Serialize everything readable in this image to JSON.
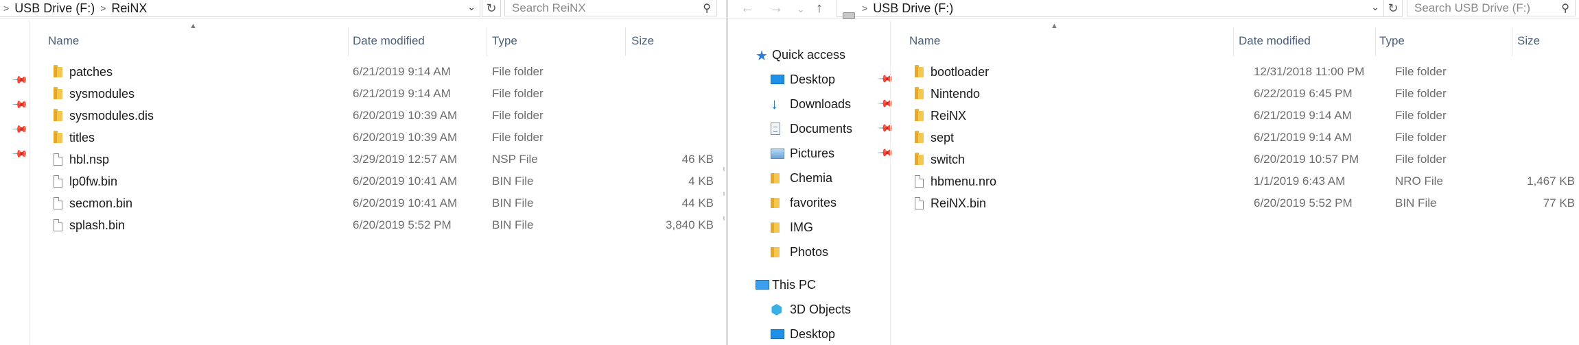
{
  "left": {
    "breadcrumb": [
      "USB Drive (F:)",
      "ReiNX"
    ],
    "search_placeholder": "Search ReiNX",
    "columns": {
      "name": "Name",
      "date": "Date modified",
      "type": "Type",
      "size": "Size"
    },
    "files": [
      {
        "name": "patches",
        "date": "6/21/2019 9:14 AM",
        "type": "File folder",
        "size": "",
        "icon": "folder-icon"
      },
      {
        "name": "sysmodules",
        "date": "6/21/2019 9:14 AM",
        "type": "File folder",
        "size": "",
        "icon": "folder-icon"
      },
      {
        "name": "sysmodules.dis",
        "date": "6/20/2019 10:39 AM",
        "type": "File folder",
        "size": "",
        "icon": "folder-icon"
      },
      {
        "name": "titles",
        "date": "6/20/2019 10:39 AM",
        "type": "File folder",
        "size": "",
        "icon": "folder-icon"
      },
      {
        "name": "hbl.nsp",
        "date": "3/29/2019 12:57 AM",
        "type": "NSP File",
        "size": "46 KB",
        "icon": "file-icon"
      },
      {
        "name": "lp0fw.bin",
        "date": "6/20/2019 10:41 AM",
        "type": "BIN File",
        "size": "4 KB",
        "icon": "file-icon"
      },
      {
        "name": "secmon.bin",
        "date": "6/20/2019 10:41 AM",
        "type": "BIN File",
        "size": "44 KB",
        "icon": "file-icon"
      },
      {
        "name": "splash.bin",
        "date": "6/20/2019 5:52 PM",
        "type": "BIN File",
        "size": "3,840 KB",
        "icon": "file-icon"
      }
    ]
  },
  "right": {
    "breadcrumb": [
      "USB Drive (F:)"
    ],
    "search_placeholder": "Search USB Drive (F:)",
    "columns": {
      "name": "Name",
      "date": "Date modified",
      "type": "Type",
      "size": "Size"
    },
    "sidebar": {
      "quick_access": "Quick access",
      "quick_items": [
        {
          "label": "Desktop",
          "icon": "desktop-icon",
          "pinned": true
        },
        {
          "label": "Downloads",
          "icon": "download-icon",
          "pinned": true
        },
        {
          "label": "Documents",
          "icon": "documents-icon",
          "pinned": true
        },
        {
          "label": "Pictures",
          "icon": "pictures-icon",
          "pinned": true
        },
        {
          "label": "Chemia",
          "icon": "folder-icon",
          "pinned": false
        },
        {
          "label": "favorites",
          "icon": "folder-icon",
          "pinned": false
        },
        {
          "label": "IMG",
          "icon": "folder-icon",
          "pinned": false
        },
        {
          "label": "Photos",
          "icon": "folder-icon",
          "pinned": false
        }
      ],
      "this_pc": "This PC",
      "pc_items": [
        {
          "label": "3D Objects",
          "icon": "3d-objects-icon"
        },
        {
          "label": "Desktop",
          "icon": "desktop-icon"
        }
      ]
    },
    "files": [
      {
        "name": "bootloader",
        "date": "12/31/2018 11:00 PM",
        "type": "File folder",
        "size": "",
        "icon": "folder-icon"
      },
      {
        "name": "Nintendo",
        "date": "6/22/2019 6:45 PM",
        "type": "File folder",
        "size": "",
        "icon": "folder-icon"
      },
      {
        "name": "ReiNX",
        "date": "6/21/2019 9:14 AM",
        "type": "File folder",
        "size": "",
        "icon": "folder-icon"
      },
      {
        "name": "sept",
        "date": "6/21/2019 9:14 AM",
        "type": "File folder",
        "size": "",
        "icon": "folder-icon"
      },
      {
        "name": "switch",
        "date": "6/20/2019 10:57 PM",
        "type": "File folder",
        "size": "",
        "icon": "folder-icon"
      },
      {
        "name": "hbmenu.nro",
        "date": "1/1/2019 6:43 AM",
        "type": "NRO File",
        "size": "1,467 KB",
        "icon": "file-icon"
      },
      {
        "name": "ReiNX.bin",
        "date": "6/20/2019 5:52 PM",
        "type": "BIN File",
        "size": "77 KB",
        "icon": "file-icon"
      }
    ]
  }
}
